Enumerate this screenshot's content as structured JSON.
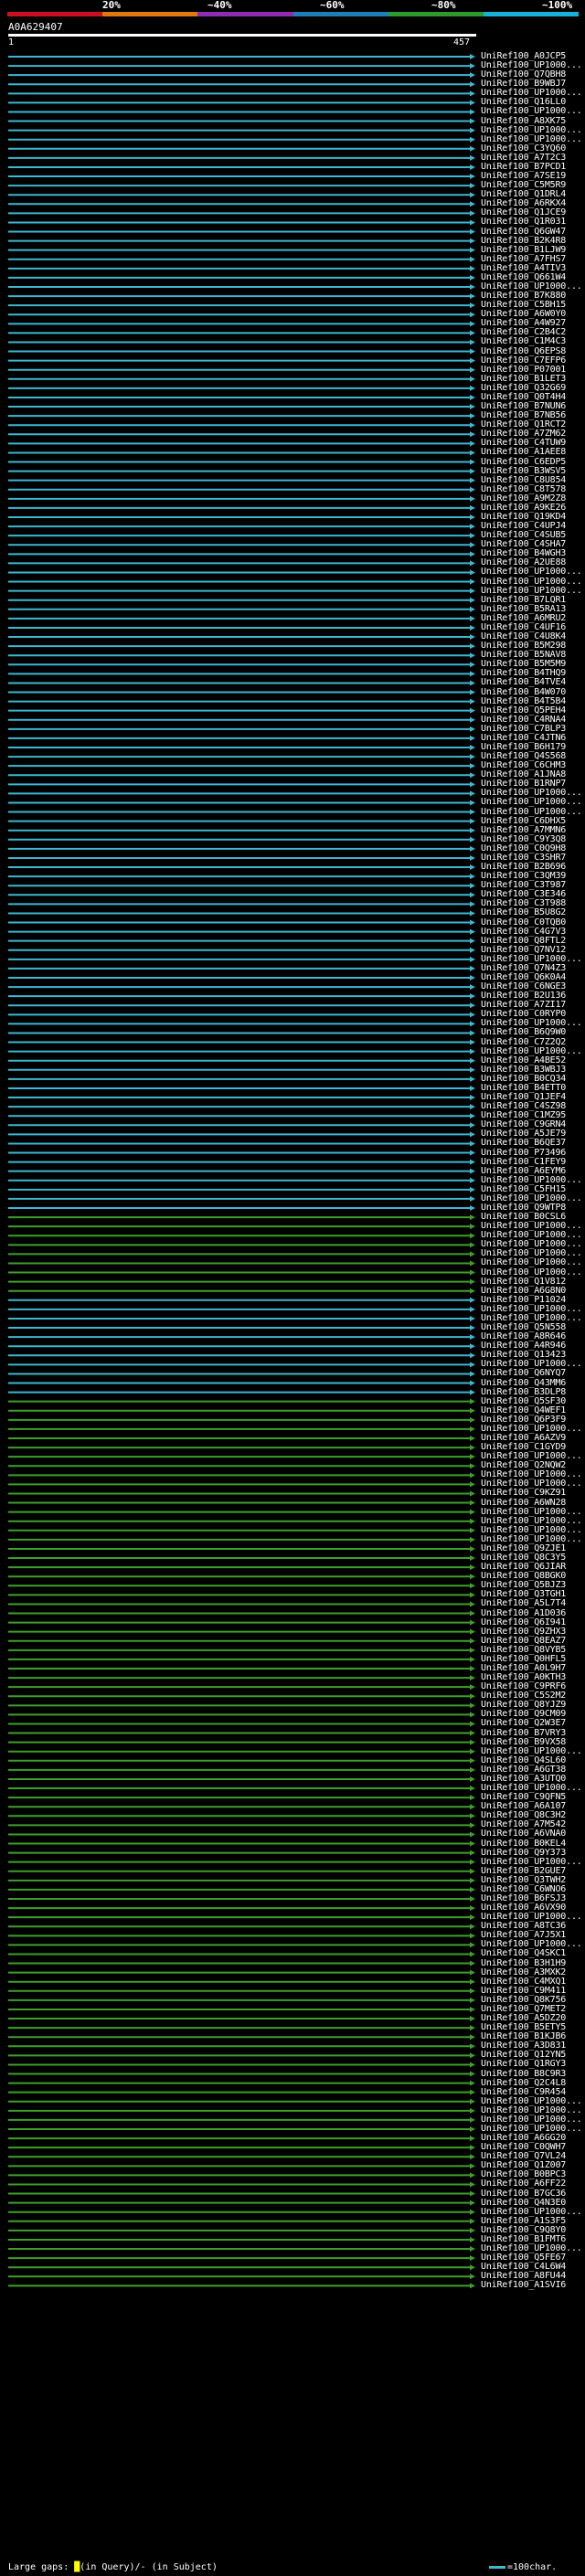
{
  "scale": {
    "marks": [
      "20%",
      "~40%",
      "~60%",
      "~80%",
      "~100%"
    ],
    "colors": [
      "#c8101e",
      "#e07a10",
      "#8e2db2",
      "#1e7fb8",
      "#2e9a2e",
      "#18b2d6"
    ]
  },
  "query": {
    "name": "A0A629407",
    "start": "1",
    "end": "457"
  },
  "hit_colors": {
    "cyan": "#3fb7cf",
    "green": "#3f9f2a"
  },
  "hits": [
    {
      "label": "UniRef100_A0JCP5",
      "color": "cyan"
    },
    {
      "label": "UniRef100_UP1000...",
      "color": "cyan"
    },
    {
      "label": "UniRef100_Q7QBH8",
      "color": "cyan"
    },
    {
      "label": "UniRef100_B9WBJ7",
      "color": "cyan"
    },
    {
      "label": "UniRef100_UP1000...",
      "color": "cyan"
    },
    {
      "label": "UniRef100_Q16LL0",
      "color": "cyan"
    },
    {
      "label": "UniRef100_UP1000...",
      "color": "cyan"
    },
    {
      "label": "UniRef100_A8XK75",
      "color": "cyan"
    },
    {
      "label": "UniRef100_UP1000...",
      "color": "cyan"
    },
    {
      "label": "UniRef100_UP1000...",
      "color": "cyan"
    },
    {
      "label": "UniRef100_C3YQ60",
      "color": "cyan"
    },
    {
      "label": "UniRef100_A7T2C3",
      "color": "cyan"
    },
    {
      "label": "UniRef100_B7PCD1",
      "color": "cyan"
    },
    {
      "label": "UniRef100_A7SE19",
      "color": "cyan"
    },
    {
      "label": "UniRef100_C5M5R9",
      "color": "cyan"
    },
    {
      "label": "UniRef100_Q1DRL4",
      "color": "cyan"
    },
    {
      "label": "UniRef100_A6RKX4",
      "color": "cyan"
    },
    {
      "label": "UniRef100_Q1JCE9",
      "color": "cyan"
    },
    {
      "label": "UniRef100_Q1R031",
      "color": "cyan"
    },
    {
      "label": "UniRef100_Q6GW47",
      "color": "cyan"
    },
    {
      "label": "UniRef100_B2K4R8",
      "color": "cyan"
    },
    {
      "label": "UniRef100_B1LJW9",
      "color": "cyan"
    },
    {
      "label": "UniRef100_A7FHS7",
      "color": "cyan"
    },
    {
      "label": "UniRef100_A4TIV3",
      "color": "cyan"
    },
    {
      "label": "UniRef100_Q661W4",
      "color": "cyan"
    },
    {
      "label": "UniRef100_UP1000...",
      "color": "cyan"
    },
    {
      "label": "UniRef100_B7K880",
      "color": "cyan"
    },
    {
      "label": "UniRef100_C5BH15",
      "color": "cyan"
    },
    {
      "label": "UniRef100_A6W0Y0",
      "color": "cyan"
    },
    {
      "label": "UniRef100_A4W927",
      "color": "cyan"
    },
    {
      "label": "UniRef100_C2B4C2",
      "color": "cyan"
    },
    {
      "label": "UniRef100_C1M4C3",
      "color": "cyan"
    },
    {
      "label": "UniRef100_Q6EPS8",
      "color": "cyan"
    },
    {
      "label": "UniRef100_C7EFP6",
      "color": "cyan"
    },
    {
      "label": "UniRef100_P07001",
      "color": "cyan"
    },
    {
      "label": "UniRef100_B1LET3",
      "color": "cyan"
    },
    {
      "label": "UniRef100_Q32G69",
      "color": "cyan"
    },
    {
      "label": "UniRef100_Q0T4H4",
      "color": "cyan"
    },
    {
      "label": "UniRef100_B7NUN6",
      "color": "cyan"
    },
    {
      "label": "UniRef100_B7NB56",
      "color": "cyan"
    },
    {
      "label": "UniRef100_Q1RCT2",
      "color": "cyan"
    },
    {
      "label": "UniRef100_A7ZM62",
      "color": "cyan"
    },
    {
      "label": "UniRef100_C4TUW9",
      "color": "cyan"
    },
    {
      "label": "UniRef100_A1AEE8",
      "color": "cyan"
    },
    {
      "label": "UniRef100_C6EDP5",
      "color": "cyan"
    },
    {
      "label": "UniRef100_B3WSV5",
      "color": "cyan"
    },
    {
      "label": "UniRef100_C8U854",
      "color": "cyan"
    },
    {
      "label": "UniRef100_C8T578",
      "color": "cyan"
    },
    {
      "label": "UniRef100_A9M2Z8",
      "color": "cyan"
    },
    {
      "label": "UniRef100_A9KE26",
      "color": "cyan"
    },
    {
      "label": "UniRef100_Q19KD4",
      "color": "cyan"
    },
    {
      "label": "UniRef100_C4UPJ4",
      "color": "cyan"
    },
    {
      "label": "UniRef100_C4SUB5",
      "color": "cyan"
    },
    {
      "label": "UniRef100_C4SHA7",
      "color": "cyan"
    },
    {
      "label": "UniRef100_B4WGH3",
      "color": "cyan"
    },
    {
      "label": "UniRef100_A2UE88",
      "color": "cyan"
    },
    {
      "label": "UniRef100_UP1000...",
      "color": "cyan"
    },
    {
      "label": "UniRef100_UP1000...",
      "color": "cyan"
    },
    {
      "label": "UniRef100_UP1000...",
      "color": "cyan"
    },
    {
      "label": "UniRef100_B7LQR1",
      "color": "cyan"
    },
    {
      "label": "UniRef100_B5RA13",
      "color": "cyan"
    },
    {
      "label": "UniRef100_A6MRU2",
      "color": "cyan"
    },
    {
      "label": "UniRef100_C4UF16",
      "color": "cyan"
    },
    {
      "label": "UniRef100_C4U8K4",
      "color": "cyan"
    },
    {
      "label": "UniRef100_B5M298",
      "color": "cyan"
    },
    {
      "label": "UniRef100_B5NAV8",
      "color": "cyan"
    },
    {
      "label": "UniRef100_B5M5M9",
      "color": "cyan"
    },
    {
      "label": "UniRef100_B4THQ9",
      "color": "cyan"
    },
    {
      "label": "UniRef100_B4TVE4",
      "color": "cyan"
    },
    {
      "label": "UniRef100_B4W070",
      "color": "cyan"
    },
    {
      "label": "UniRef100_B4T5B4",
      "color": "cyan"
    },
    {
      "label": "UniRef100_Q5PEH4",
      "color": "cyan"
    },
    {
      "label": "UniRef100_C4RNA4",
      "color": "cyan"
    },
    {
      "label": "UniRef100_C7BLP3",
      "color": "cyan"
    },
    {
      "label": "UniRef100_C4JTN6",
      "color": "cyan"
    },
    {
      "label": "UniRef100_B6H179",
      "color": "cyan"
    },
    {
      "label": "UniRef100_Q4S568",
      "color": "cyan"
    },
    {
      "label": "UniRef100_C6CHM3",
      "color": "cyan"
    },
    {
      "label": "UniRef100_A1JNA8",
      "color": "cyan"
    },
    {
      "label": "UniRef100_B1RNP7",
      "color": "cyan"
    },
    {
      "label": "UniRef100_UP1000...",
      "color": "cyan"
    },
    {
      "label": "UniRef100_UP1000...",
      "color": "cyan"
    },
    {
      "label": "UniRef100_UP1000...",
      "color": "cyan"
    },
    {
      "label": "UniRef100_C6DHX5",
      "color": "cyan"
    },
    {
      "label": "UniRef100_A7MMN6",
      "color": "cyan"
    },
    {
      "label": "UniRef100_C9Y3Q8",
      "color": "cyan"
    },
    {
      "label": "UniRef100_C0Q9H8",
      "color": "cyan"
    },
    {
      "label": "UniRef100_C3SHR7",
      "color": "cyan"
    },
    {
      "label": "UniRef100_B2B696",
      "color": "cyan"
    },
    {
      "label": "UniRef100_C3QM39",
      "color": "cyan"
    },
    {
      "label": "UniRef100_C3T987",
      "color": "cyan"
    },
    {
      "label": "UniRef100_C3E346",
      "color": "cyan"
    },
    {
      "label": "UniRef100_C3T988",
      "color": "cyan"
    },
    {
      "label": "UniRef100_B5U8G2",
      "color": "cyan"
    },
    {
      "label": "UniRef100_C0TQB0",
      "color": "cyan"
    },
    {
      "label": "UniRef100_C4G7V3",
      "color": "cyan"
    },
    {
      "label": "UniRef100_Q8FTL2",
      "color": "cyan"
    },
    {
      "label": "UniRef100_Q7NV12",
      "color": "cyan"
    },
    {
      "label": "UniRef100_UP1000...",
      "color": "cyan"
    },
    {
      "label": "UniRef100_Q7N4Z3",
      "color": "cyan"
    },
    {
      "label": "UniRef100_Q6K0A4",
      "color": "cyan"
    },
    {
      "label": "UniRef100_C6NGE3",
      "color": "cyan"
    },
    {
      "label": "UniRef100_B2U136",
      "color": "cyan"
    },
    {
      "label": "UniRef100_A7ZI17",
      "color": "cyan"
    },
    {
      "label": "UniRef100_C0RYP0",
      "color": "cyan"
    },
    {
      "label": "UniRef100_UP1000...",
      "color": "cyan"
    },
    {
      "label": "UniRef100_B6Q9W0",
      "color": "cyan"
    },
    {
      "label": "UniRef100_C7Z2Q2",
      "color": "cyan"
    },
    {
      "label": "UniRef100_UP1000...",
      "color": "cyan"
    },
    {
      "label": "UniRef100_A4BE52",
      "color": "cyan"
    },
    {
      "label": "UniRef100_B3WBJ3",
      "color": "cyan"
    },
    {
      "label": "UniRef100_B0CQ34",
      "color": "cyan"
    },
    {
      "label": "UniRef100_B4ETT0",
      "color": "cyan"
    },
    {
      "label": "UniRef100_Q1JEF4",
      "color": "cyan"
    },
    {
      "label": "UniRef100_C4SZ98",
      "color": "cyan"
    },
    {
      "label": "UniRef100_C1MZ95",
      "color": "cyan"
    },
    {
      "label": "UniRef100_C9GRN4",
      "color": "cyan"
    },
    {
      "label": "UniRef100_A5JE79",
      "color": "cyan"
    },
    {
      "label": "UniRef100_B6QE37",
      "color": "cyan"
    },
    {
      "label": "UniRef100_P73496",
      "color": "cyan"
    },
    {
      "label": "UniRef100_C1FEY9",
      "color": "cyan"
    },
    {
      "label": "UniRef100_A6EYM6",
      "color": "cyan"
    },
    {
      "label": "UniRef100_UP1000...",
      "color": "cyan"
    },
    {
      "label": "UniRef100_C5FH15",
      "color": "cyan"
    },
    {
      "label": "UniRef100_UP1000...",
      "color": "cyan"
    },
    {
      "label": "UniRef100_Q9WTP8",
      "color": "cyan"
    },
    {
      "label": "UniRef100_B0CSL6",
      "color": "green"
    },
    {
      "label": "UniRef100_UP1000...",
      "color": "green"
    },
    {
      "label": "UniRef100_UP1000...",
      "color": "green"
    },
    {
      "label": "UniRef100_UP1000...",
      "color": "green"
    },
    {
      "label": "UniRef100_UP1000...",
      "color": "green"
    },
    {
      "label": "UniRef100_UP1000...",
      "color": "green"
    },
    {
      "label": "UniRef100_UP1000...",
      "color": "green"
    },
    {
      "label": "UniRef100_Q1V812",
      "color": "green"
    },
    {
      "label": "UniRef100_A6G8N0",
      "color": "green"
    },
    {
      "label": "UniRef100_P11024",
      "color": "cyan"
    },
    {
      "label": "UniRef100_UP1000...",
      "color": "cyan"
    },
    {
      "label": "UniRef100_UP1000...",
      "color": "cyan"
    },
    {
      "label": "UniRef100_Q5N558",
      "color": "cyan"
    },
    {
      "label": "UniRef100_A8R646",
      "color": "cyan"
    },
    {
      "label": "UniRef100_A4R946",
      "color": "cyan"
    },
    {
      "label": "UniRef100_Q13423",
      "color": "cyan"
    },
    {
      "label": "UniRef100_UP1000...",
      "color": "cyan"
    },
    {
      "label": "UniRef100_Q6NYQ7",
      "color": "cyan"
    },
    {
      "label": "UniRef100_Q43MM6",
      "color": "cyan"
    },
    {
      "label": "UniRef100_B3DLP8",
      "color": "cyan"
    },
    {
      "label": "UniRef100_Q5SF30",
      "color": "green"
    },
    {
      "label": "UniRef100_Q4WEF1",
      "color": "green"
    },
    {
      "label": "UniRef100_Q6P3F9",
      "color": "green"
    },
    {
      "label": "UniRef100_UP1000...",
      "color": "green"
    },
    {
      "label": "UniRef100_A6AZV9",
      "color": "green"
    },
    {
      "label": "UniRef100_C1GYD9",
      "color": "green"
    },
    {
      "label": "UniRef100_UP1000...",
      "color": "green"
    },
    {
      "label": "UniRef100_Q2NQW2",
      "color": "green"
    },
    {
      "label": "UniRef100_UP1000...",
      "color": "green"
    },
    {
      "label": "UniRef100_UP1000...",
      "color": "green"
    },
    {
      "label": "UniRef100_C9KZ91",
      "color": "green"
    },
    {
      "label": "UniRef100_A6WN28",
      "color": "green"
    },
    {
      "label": "UniRef100_UP1000...",
      "color": "green"
    },
    {
      "label": "UniRef100_UP1000...",
      "color": "green"
    },
    {
      "label": "UniRef100_UP1000...",
      "color": "green"
    },
    {
      "label": "UniRef100_UP1000...",
      "color": "green"
    },
    {
      "label": "UniRef100_Q9ZJE1",
      "color": "green"
    },
    {
      "label": "UniRef100_Q8C3Y5",
      "color": "green"
    },
    {
      "label": "UniRef100_Q6JIAR",
      "color": "green"
    },
    {
      "label": "UniRef100_Q8BGK0",
      "color": "green"
    },
    {
      "label": "UniRef100_Q5BJZ3",
      "color": "green"
    },
    {
      "label": "UniRef100_Q3TGH1",
      "color": "green"
    },
    {
      "label": "UniRef100_A5L7T4",
      "color": "green"
    },
    {
      "label": "UniRef100_A1D036",
      "color": "green"
    },
    {
      "label": "UniRef100_Q6I941",
      "color": "green"
    },
    {
      "label": "UniRef100_Q9ZHX3",
      "color": "green"
    },
    {
      "label": "UniRef100_Q8EAZ7",
      "color": "green"
    },
    {
      "label": "UniRef100_Q8VYB5",
      "color": "green"
    },
    {
      "label": "UniRef100_Q0HFL5",
      "color": "green"
    },
    {
      "label": "UniRef100_A0L9H7",
      "color": "green"
    },
    {
      "label": "UniRef100_A0KTH3",
      "color": "green"
    },
    {
      "label": "UniRef100_C9PRF6",
      "color": "green"
    },
    {
      "label": "UniRef100_C5S2M2",
      "color": "green"
    },
    {
      "label": "UniRef100_Q8YJZ9",
      "color": "green"
    },
    {
      "label": "UniRef100_Q9CM09",
      "color": "green"
    },
    {
      "label": "UniRef100_Q2W3E7",
      "color": "green"
    },
    {
      "label": "UniRef100_B7VRY3",
      "color": "green"
    },
    {
      "label": "UniRef100_B9VX58",
      "color": "green"
    },
    {
      "label": "UniRef100_UP1000...",
      "color": "green"
    },
    {
      "label": "UniRef100_Q4SL60",
      "color": "green"
    },
    {
      "label": "UniRef100_A6GT38",
      "color": "green"
    },
    {
      "label": "UniRef100_A3UTQ0",
      "color": "green"
    },
    {
      "label": "UniRef100_UP1000...",
      "color": "green"
    },
    {
      "label": "UniRef100_C9QFN5",
      "color": "green"
    },
    {
      "label": "UniRef100_A6A107",
      "color": "green"
    },
    {
      "label": "UniRef100_Q8C3H2",
      "color": "green"
    },
    {
      "label": "UniRef100_A7M542",
      "color": "green"
    },
    {
      "label": "UniRef100_A6VNA0",
      "color": "green"
    },
    {
      "label": "UniRef100_B0KEL4",
      "color": "green"
    },
    {
      "label": "UniRef100_Q9Y373",
      "color": "green"
    },
    {
      "label": "UniRef100_UP1000...",
      "color": "green"
    },
    {
      "label": "UniRef100_B2GUE7",
      "color": "green"
    },
    {
      "label": "UniRef100_Q3TWH2",
      "color": "green"
    },
    {
      "label": "UniRef100_C6WNO6",
      "color": "green"
    },
    {
      "label": "UniRef100_B6FSJ3",
      "color": "green"
    },
    {
      "label": "UniRef100_A6VX90",
      "color": "green"
    },
    {
      "label": "UniRef100_UP1000...",
      "color": "green"
    },
    {
      "label": "UniRef100_A8TC36",
      "color": "green"
    },
    {
      "label": "UniRef100_A7J5X1",
      "color": "green"
    },
    {
      "label": "UniRef100_UP1000...",
      "color": "green"
    },
    {
      "label": "UniRef100_Q4SKC1",
      "color": "green"
    },
    {
      "label": "UniRef100_B3H1H9",
      "color": "green"
    },
    {
      "label": "UniRef100_A3MXK2",
      "color": "green"
    },
    {
      "label": "UniRef100_C4MXQ1",
      "color": "green"
    },
    {
      "label": "UniRef100_C9M411",
      "color": "green"
    },
    {
      "label": "UniRef100_Q8K756",
      "color": "green"
    },
    {
      "label": "UniRef100_Q7MET2",
      "color": "green"
    },
    {
      "label": "UniRef100_A5DZ20",
      "color": "green"
    },
    {
      "label": "UniRef100_B5ETY5",
      "color": "green"
    },
    {
      "label": "UniRef100_B1KJB6",
      "color": "green"
    },
    {
      "label": "UniRef100_A3D831",
      "color": "green"
    },
    {
      "label": "UniRef100_Q12YN5",
      "color": "green"
    },
    {
      "label": "UniRef100_Q1RGY3",
      "color": "green"
    },
    {
      "label": "UniRef100_B8C9R3",
      "color": "green"
    },
    {
      "label": "UniRef100_Q2C4L8",
      "color": "green"
    },
    {
      "label": "UniRef100_C9R454",
      "color": "green"
    },
    {
      "label": "UniRef100_UP1000...",
      "color": "green"
    },
    {
      "label": "UniRef100_UP1000...",
      "color": "green"
    },
    {
      "label": "UniRef100_UP1000...",
      "color": "green"
    },
    {
      "label": "UniRef100_UP1000...",
      "color": "green"
    },
    {
      "label": "UniRef100_A6GG20",
      "color": "green"
    },
    {
      "label": "UniRef100_C0QWH7",
      "color": "green"
    },
    {
      "label": "UniRef100_Q7VL24",
      "color": "green"
    },
    {
      "label": "UniRef100_Q1Z007",
      "color": "green"
    },
    {
      "label": "UniRef100_B0BPC3",
      "color": "green"
    },
    {
      "label": "UniRef100_A6FF22",
      "color": "green"
    },
    {
      "label": "UniRef100_B7GC36",
      "color": "green"
    },
    {
      "label": "UniRef100_Q4N3E0",
      "color": "green"
    },
    {
      "label": "UniRef100_UP1000...",
      "color": "green"
    },
    {
      "label": "UniRef100_A1S3F5",
      "color": "green"
    },
    {
      "label": "UniRef100_C9Q8Y0",
      "color": "green"
    },
    {
      "label": "UniRef100_B1FMT6",
      "color": "green"
    },
    {
      "label": "UniRef100_UP1000...",
      "color": "green"
    },
    {
      "label": "UniRef100_Q5FE67",
      "color": "green"
    },
    {
      "label": "UniRef100_C4L6W4",
      "color": "green"
    },
    {
      "label": "UniRef100_A8FU44",
      "color": "green"
    },
    {
      "label": "UniRef100_A1SVI6",
      "color": "green"
    }
  ],
  "legend": {
    "prefix": "Large gaps:",
    "marker": "█",
    "in_query": "(in Query)",
    "sep": "/",
    "dash": "-",
    "in_subject": "(in Subject)",
    "scale_text": "=100char."
  }
}
